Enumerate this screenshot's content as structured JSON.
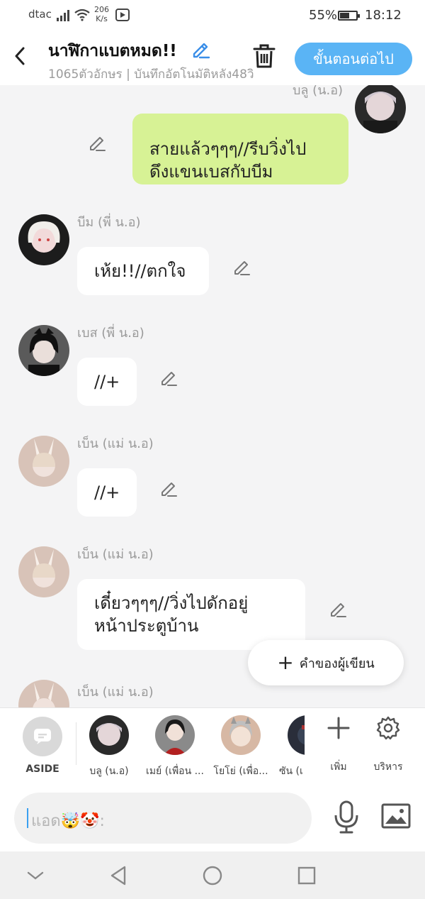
{
  "status_bar": {
    "carrier": "dtac",
    "net_speed": "206",
    "net_speed_unit": "K/s",
    "battery_percent": "55%",
    "time": "18:12"
  },
  "header": {
    "title": "นาฬิกาแบตหมด!!",
    "meta": "1065ตัวอักษร | บันทึกอัตโนมัติหลัง48วิ",
    "next_label": "ขั้นตอนต่อไป"
  },
  "messages": [
    {
      "sender": "บลู (น.อ)",
      "text": "สายแล้วๆๆๆ//รีบวิ่งไป\nดึงแขนเบสกับบีม",
      "side": "right"
    },
    {
      "sender": "บีม (พี่ น.อ)",
      "text": "เห้ย!!//ตกใจ",
      "side": "left"
    },
    {
      "sender": "เบส (พี่ น.อ)",
      "text": "//+",
      "side": "left"
    },
    {
      "sender": "เบ็น (แม่ น.อ)",
      "text": "//+",
      "side": "left"
    },
    {
      "sender": "เบ็น (แม่ น.อ)",
      "text": "เดี๋ยวๆๆๆ//วิ่งไปดักอยู่\nหน้าประตูบ้าน",
      "side": "left"
    },
    {
      "sender": "เบ็น (แม่ น.อ)",
      "text": "",
      "side": "left"
    }
  ],
  "author_button": "คำของผู้เขียน",
  "character_bar": {
    "aside_label": "ASIDE",
    "characters": [
      {
        "label": "บลู (น.อ)"
      },
      {
        "label": "เมย์ (เพื่อน ..."
      },
      {
        "label": "โยโย่ (เพื่อ..."
      },
      {
        "label": "ซัน (เ"
      }
    ],
    "add_label": "เพิ่ม",
    "manage_label": "บริหาร"
  },
  "input": {
    "placeholder": "แอด🤯🤡:"
  },
  "colors": {
    "accent": "#5ab4f5",
    "own_bubble": "#d7f295",
    "other_bubble": "#ffffff",
    "background": "#f4f4f5"
  }
}
